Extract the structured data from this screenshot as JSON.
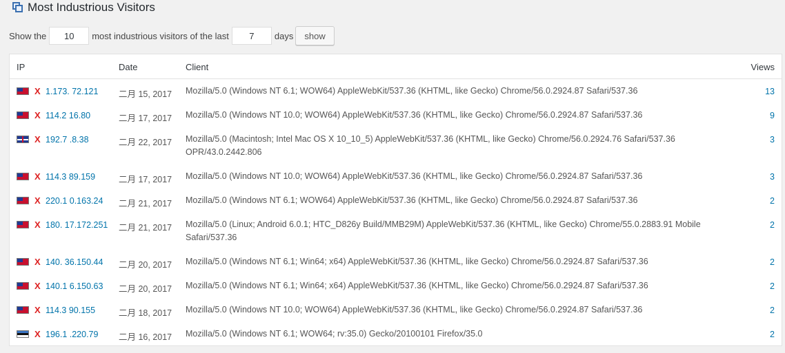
{
  "header": {
    "title": "Most Industrious Visitors",
    "icon": "widget-icon"
  },
  "controls": {
    "prefix": "Show the",
    "count_value": "10",
    "middle": "most industrious visitors of the last",
    "days_value": "7",
    "suffix": "days",
    "show_label": "show"
  },
  "table": {
    "headers": {
      "ip": "IP",
      "date": "Date",
      "client": "Client",
      "views": "Views"
    },
    "rows": [
      {
        "flag": "tw",
        "del": "X",
        "ip": "1.173.  72.121",
        "date": "二月 15, 2017",
        "client": "Mozilla/5.0 (Windows NT 6.1; WOW64) AppleWebKit/537.36 (KHTML, like Gecko) Chrome/56.0.2924.87 Safari/537.36",
        "views": "13"
      },
      {
        "flag": "tw",
        "del": "X",
        "ip": "114.2  16.80",
        "date": "二月 17, 2017",
        "client": "Mozilla/5.0 (Windows NT 10.0; WOW64) AppleWebKit/537.36 (KHTML, like Gecko) Chrome/56.0.2924.87 Safari/537.36",
        "views": "9"
      },
      {
        "flag": "uk",
        "del": "X",
        "ip": "192.7  .8.38",
        "date": "二月 22, 2017",
        "client": "Mozilla/5.0 (Macintosh; Intel Mac OS X 10_10_5) AppleWebKit/537.36 (KHTML, like Gecko) Chrome/56.0.2924.76 Safari/537.36 OPR/43.0.2442.806",
        "views": "3"
      },
      {
        "flag": "tw",
        "del": "X",
        "ip": "114.3  89.159",
        "date": "二月 17, 2017",
        "client": "Mozilla/5.0 (Windows NT 10.0; WOW64) AppleWebKit/537.36 (KHTML, like Gecko) Chrome/56.0.2924.87 Safari/537.36",
        "views": "3"
      },
      {
        "flag": "tw",
        "del": "X",
        "ip": "220.1  0.163.24",
        "date": "二月 21, 2017",
        "client": "Mozilla/5.0 (Windows NT 6.1; WOW64) AppleWebKit/537.36 (KHTML, like Gecko) Chrome/56.0.2924.87 Safari/537.36",
        "views": "2"
      },
      {
        "flag": "tw",
        "del": "X",
        "ip": "180.  17.172.251",
        "date": "二月 21, 2017",
        "client": "Mozilla/5.0 (Linux; Android 6.0.1; HTC_D826y Build/MMB29M) AppleWebKit/537.36 (KHTML, like Gecko) Chrome/55.0.2883.91 Mobile Safari/537.36",
        "views": "2"
      },
      {
        "flag": "tw",
        "del": "X",
        "ip": "140.  36.150.44",
        "date": "二月 20, 2017",
        "client": "Mozilla/5.0 (Windows NT 6.1; Win64; x64) AppleWebKit/537.36 (KHTML, like Gecko) Chrome/56.0.2924.87 Safari/537.36",
        "views": "2"
      },
      {
        "flag": "tw",
        "del": "X",
        "ip": "140.1  6.150.63",
        "date": "二月 20, 2017",
        "client": "Mozilla/5.0 (Windows NT 6.1; Win64; x64) AppleWebKit/537.36 (KHTML, like Gecko) Chrome/56.0.2924.87 Safari/537.36",
        "views": "2"
      },
      {
        "flag": "tw",
        "del": "X",
        "ip": "114.3  90.155",
        "date": "二月 18, 2017",
        "client": "Mozilla/5.0 (Windows NT 10.0; WOW64) AppleWebKit/537.36 (KHTML, like Gecko) Chrome/56.0.2924.87 Safari/537.36",
        "views": "2"
      },
      {
        "flag": "ee",
        "del": "X",
        "ip": "196.1  .220.79",
        "date": "二月 16, 2017",
        "client": "Mozilla/5.0 (Windows NT 6.1; WOW64; rv:35.0) Gecko/20100101 Firefox/35.0",
        "views": "2"
      }
    ]
  }
}
